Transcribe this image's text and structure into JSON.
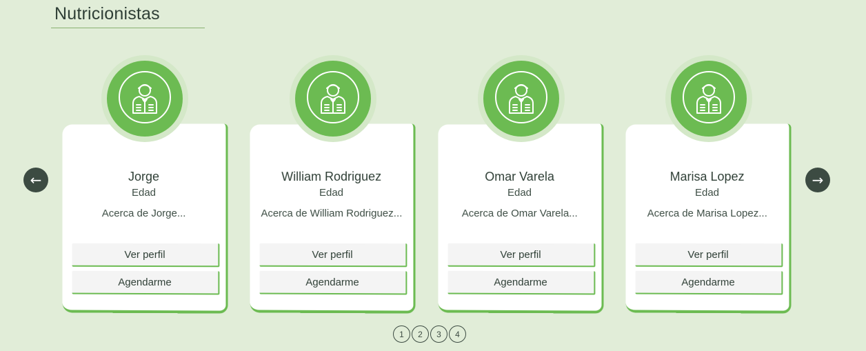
{
  "section": {
    "title": "Nutricionistas"
  },
  "nav": {
    "prev_icon": "←",
    "next_icon": "→"
  },
  "cards": [
    {
      "name": "Jorge",
      "age": "Edad",
      "about": "Acerca de Jorge...",
      "profile_label": "Ver perfil",
      "schedule_label": "Agendarme"
    },
    {
      "name": "William Rodriguez",
      "age": "Edad",
      "about": "Acerca de William Rodriguez...",
      "profile_label": "Ver perfil",
      "schedule_label": "Agendarme"
    },
    {
      "name": "Omar Varela",
      "age": "Edad",
      "about": "Acerca de Omar Varela...",
      "profile_label": "Ver perfil",
      "schedule_label": "Agendarme"
    },
    {
      "name": "Marisa Lopez",
      "age": "Edad",
      "about": "Acerca de Marisa Lopez...",
      "profile_label": "Ver perfil",
      "schedule_label": "Agendarme"
    }
  ],
  "pagination": {
    "pages": [
      "1",
      "2",
      "3",
      "4"
    ]
  },
  "colors": {
    "background": "#e1edd8",
    "accent": "#6cbb52",
    "dark": "#3c4b42",
    "card": "#ffffff",
    "button": "#f4f4f4"
  },
  "icons": {
    "avatar": "nutritionist-person-icon"
  }
}
